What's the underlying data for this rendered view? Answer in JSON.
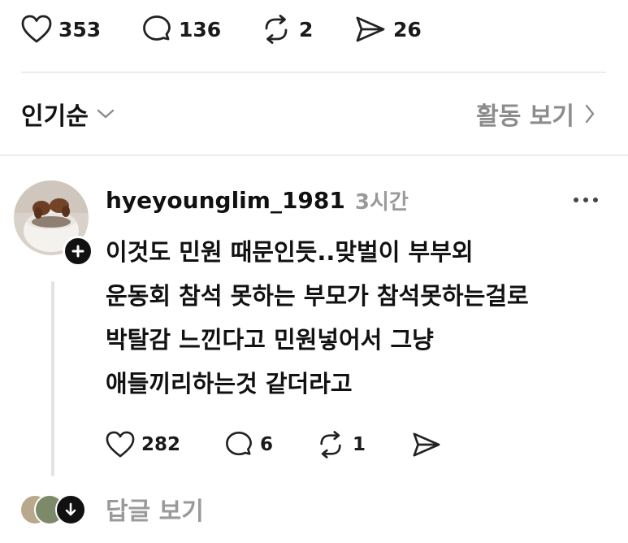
{
  "post_actions": {
    "likes": "353",
    "comments": "136",
    "reposts": "2",
    "shares": "26"
  },
  "sort_bar": {
    "sort_label": "인기순",
    "activity_label": "활동 보기"
  },
  "comment": {
    "username": "hyeyounglim_1981",
    "time": "3시간",
    "text": "이것도 민원 때문인듯..맞벌이 부부외\n운동회 참석 못하는 부모가 참석못하는걸로\n박탈감 느낀다고 민원넣어서 그냥\n애들끼리하는것 같더라고",
    "likes": "282",
    "comments": "6",
    "reposts": "1"
  },
  "replies": {
    "view_label": "답글 보기"
  }
}
